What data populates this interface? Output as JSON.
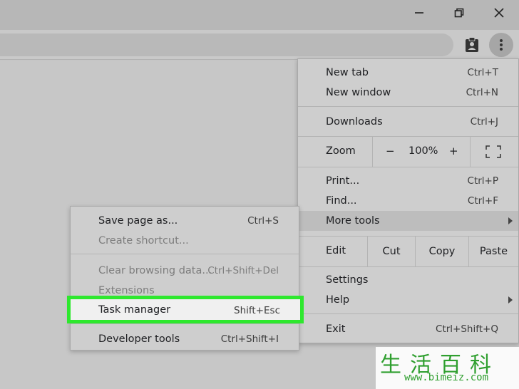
{
  "main_menu": {
    "new_tab": {
      "label": "New tab",
      "shortcut": "Ctrl+T"
    },
    "new_window": {
      "label": "New window",
      "shortcut": "Ctrl+N"
    },
    "downloads": {
      "label": "Downloads",
      "shortcut": "Ctrl+J"
    },
    "zoom": {
      "label": "Zoom",
      "minus": "−",
      "value": "100%",
      "plus": "+"
    },
    "print": {
      "label": "Print...",
      "shortcut": "Ctrl+P"
    },
    "find": {
      "label": "Find...",
      "shortcut": "Ctrl+F"
    },
    "more_tools": {
      "label": "More tools"
    },
    "edit": {
      "label": "Edit",
      "cut": "Cut",
      "copy": "Copy",
      "paste": "Paste"
    },
    "settings": {
      "label": "Settings"
    },
    "help": {
      "label": "Help"
    },
    "exit": {
      "label": "Exit",
      "shortcut": "Ctrl+Shift+Q"
    }
  },
  "sub_menu": {
    "save_page": {
      "label": "Save page as...",
      "shortcut": "Ctrl+S"
    },
    "create_shortcut": {
      "label": "Create shortcut..."
    },
    "clear_data": {
      "label": "Clear browsing data...",
      "shortcut": "Ctrl+Shift+Del"
    },
    "extensions": {
      "label": "Extensions"
    },
    "task_manager": {
      "label": "Task manager",
      "shortcut": "Shift+Esc"
    },
    "developer_tools": {
      "label": "Developer tools",
      "shortcut": "Ctrl+Shift+I"
    }
  },
  "watermark": {
    "title": "生活百科",
    "url": "www.bimeiz.com"
  },
  "colors": {
    "highlight": "#2ee82e",
    "menu_bg": "#cecece",
    "hover": "#bdbdbd"
  }
}
